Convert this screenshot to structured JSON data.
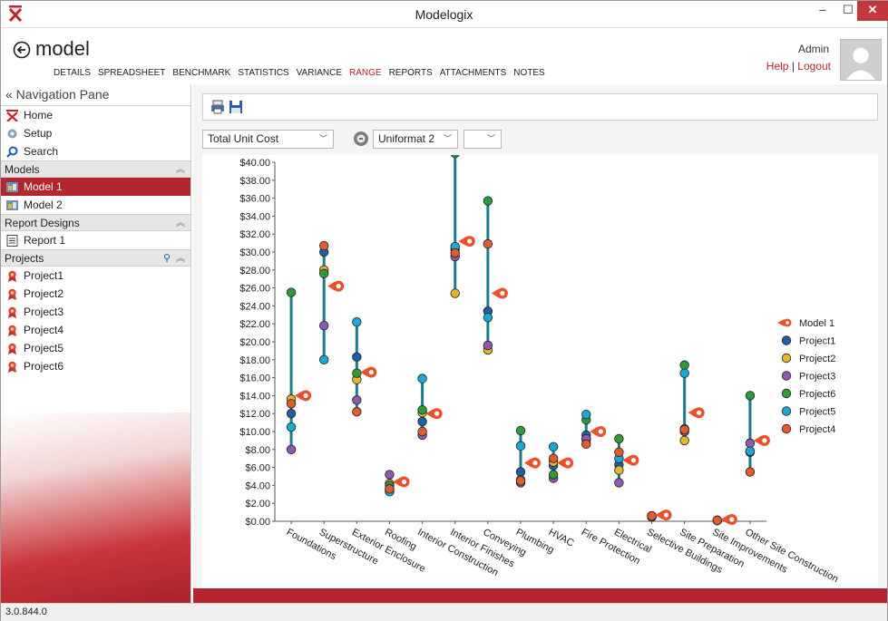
{
  "window": {
    "title": "Modelogix"
  },
  "header": {
    "page_title": "model",
    "tabs": [
      {
        "label": "DETAILS"
      },
      {
        "label": "SPREADSHEET"
      },
      {
        "label": "BENCHMARK"
      },
      {
        "label": "STATISTICS"
      },
      {
        "label": "VARIANCE"
      },
      {
        "label": "RANGE",
        "active": true
      },
      {
        "label": "REPORTS"
      },
      {
        "label": "ATTACHMENTS"
      },
      {
        "label": "NOTES"
      }
    ],
    "user": "Admin",
    "help": "Help",
    "separator": "|",
    "logout": "Logout"
  },
  "nav": {
    "title": "« Navigation Pane",
    "top_items": [
      {
        "label": "Home",
        "icon": "home-icon"
      },
      {
        "label": "Setup",
        "icon": "gear-icon"
      },
      {
        "label": "Search",
        "icon": "search-icon"
      }
    ],
    "sections": {
      "models": "Models",
      "report_designs": "Report Designs",
      "projects": "Projects"
    },
    "models": [
      "Model 1",
      "Model 2"
    ],
    "selected_model": "Model 1",
    "reports": [
      "Report 1"
    ],
    "projects": [
      "Project1",
      "Project2",
      "Project3",
      "Project4",
      "Project5",
      "Project6"
    ]
  },
  "toolbar": {
    "metric_select": "Total Unit Cost",
    "format_select": "Uniformat 2",
    "third_select": ""
  },
  "status": {
    "version": "3.0.844.0"
  },
  "colors": {
    "accent": "#b3262d",
    "range_line": "#1d7c8a"
  },
  "chart_data": {
    "type": "scatter",
    "subtype": "range",
    "categories": [
      "Foundations",
      "Superstructure",
      "Exterior Enclosure",
      "Roofing",
      "Interior Construction",
      "Interior Finishes",
      "Conveying",
      "Plumbing",
      "HVAC",
      "Fire Protection",
      "Electrical",
      "Selective Buildings",
      "Site Preparation",
      "Site Improvements",
      "Other Site Construction"
    ],
    "y_ticks": [
      "$0.00",
      "$2.00",
      "$4.00",
      "$6.00",
      "$8.00",
      "$10.00",
      "$12.00",
      "$14.00",
      "$16.00",
      "$18.00",
      "$20.00",
      "$22.00",
      "$24.00",
      "$26.00",
      "$28.00",
      "$30.00",
      "$32.00",
      "$34.00",
      "$36.00",
      "$38.00",
      "$40.00"
    ],
    "ylim": [
      0,
      40
    ],
    "legend_position": "right",
    "series": [
      {
        "name": "Model 1",
        "color": "#e8512b",
        "marker": "flag",
        "values": [
          14.0,
          26.2,
          16.6,
          4.4,
          12.0,
          31.2,
          25.4,
          6.5,
          6.5,
          10.0,
          6.8,
          0.7,
          12.1,
          0.2,
          9.0
        ]
      },
      {
        "name": "Project1",
        "color": "#1f5fa8",
        "values": [
          12.0,
          30.0,
          18.3,
          3.5,
          11.1,
          30.3,
          23.4,
          5.5,
          6.2,
          9.6,
          6.3,
          0.6,
          10.3,
          0.1,
          7.7
        ]
      },
      {
        "name": "Project2",
        "color": "#e5b62a",
        "values": [
          13.6,
          28.0,
          15.8,
          4.2,
          12.1,
          25.4,
          19.1,
          4.6,
          6.6,
          9.1,
          5.7,
          0.5,
          9.0,
          0.1,
          7.8
        ]
      },
      {
        "name": "Project3",
        "color": "#8e59b1",
        "values": [
          8.0,
          21.8,
          13.5,
          5.2,
          9.6,
          29.5,
          19.6,
          4.3,
          4.8,
          9.2,
          4.3,
          0.5,
          10.0,
          0.1,
          8.7
        ]
      },
      {
        "name": "Project6",
        "color": "#2f9a3a",
        "values": [
          25.5,
          27.6,
          16.5,
          4.0,
          12.4,
          41.0,
          35.7,
          10.1,
          5.2,
          11.3,
          9.2,
          0.5,
          17.4,
          0.1,
          14.0
        ]
      },
      {
        "name": "Project5",
        "color": "#1aa8d8",
        "values": [
          10.5,
          18.0,
          22.2,
          3.3,
          15.9,
          30.6,
          22.7,
          8.4,
          8.3,
          11.9,
          7.0,
          0.6,
          16.5,
          0.1,
          7.8
        ]
      },
      {
        "name": "Project4",
        "color": "#e05b2e",
        "values": [
          13.1,
          30.7,
          12.2,
          3.6,
          10.0,
          29.9,
          30.9,
          4.5,
          7.0,
          8.6,
          7.7,
          0.6,
          10.2,
          0.1,
          5.5
        ]
      }
    ]
  }
}
